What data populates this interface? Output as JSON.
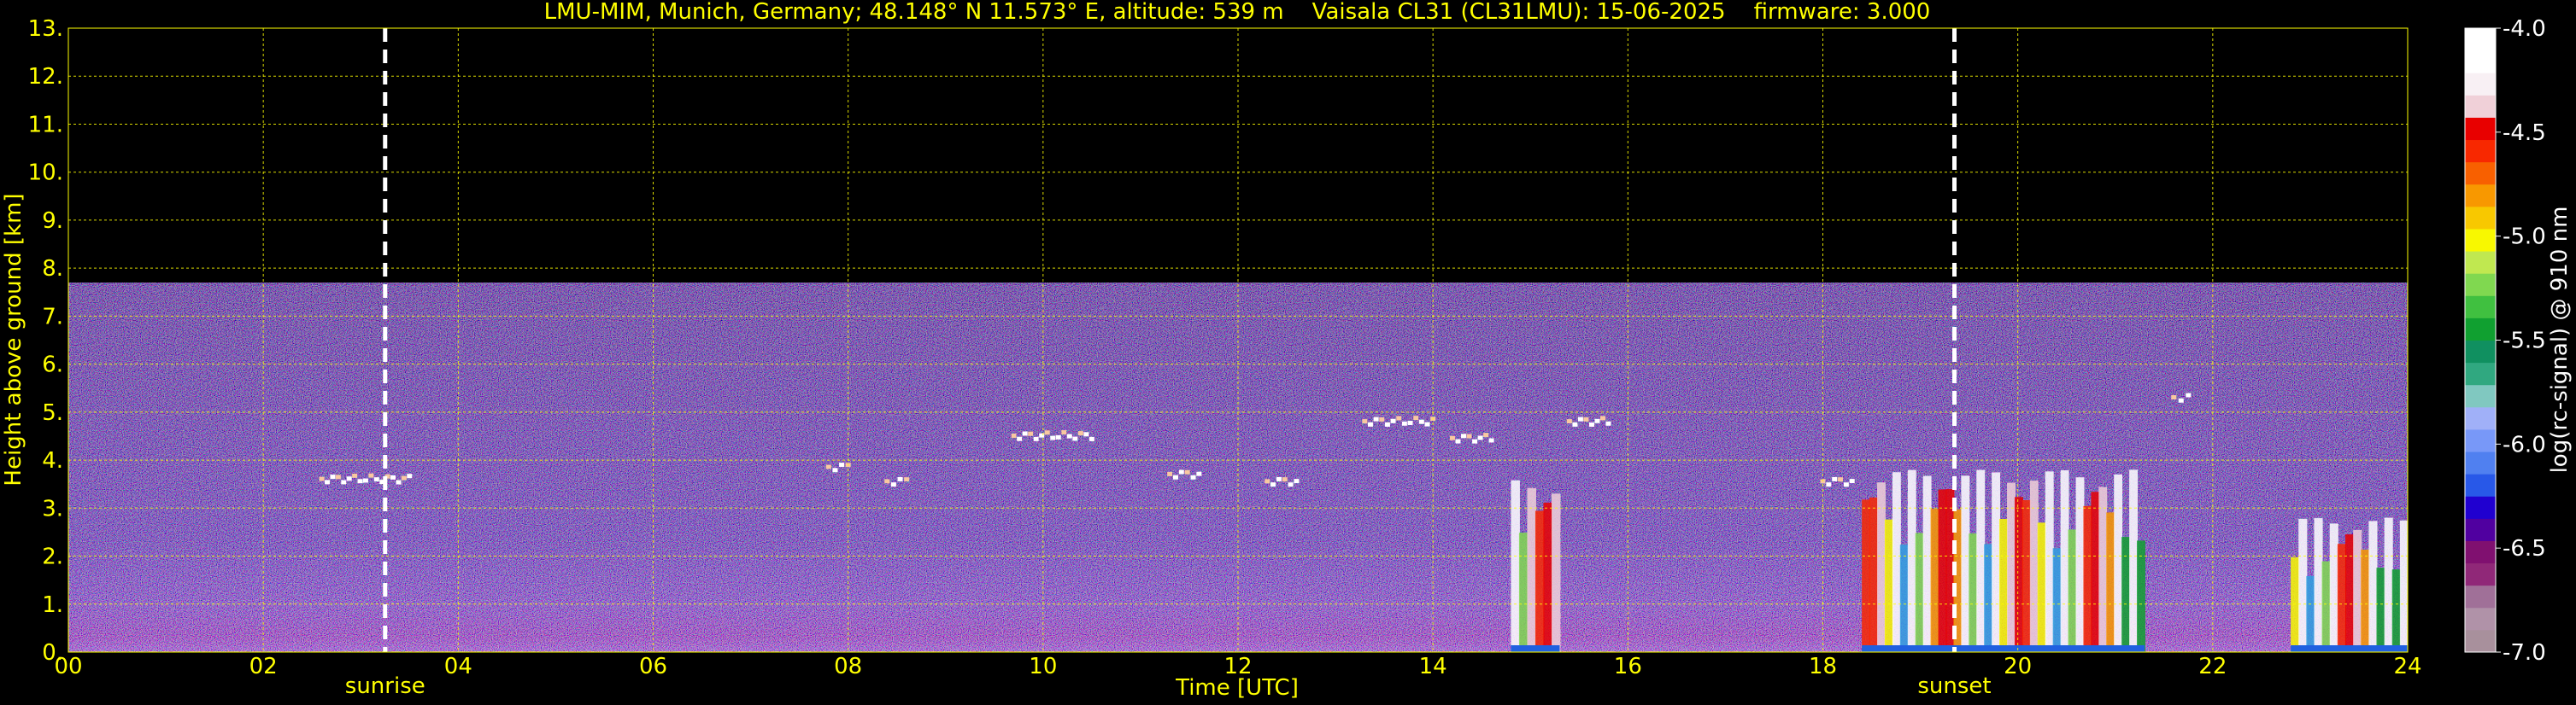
{
  "title": "LMU-MIM, Munich, Germany; 48.148° N 11.573° E, altitude: 539 m    Vaisala CL31 (CL31LMU): 15-06-2025    firmware: 3.000",
  "chart_data": {
    "type": "heatmap",
    "title": "LMU-MIM, Munich, Germany; 48.148° N 11.573° E, altitude: 539 m    Vaisala CL31 (CL31LMU): 15-06-2025    firmware: 3.000",
    "xlabel": "Time [UTC]",
    "ylabel": "Height above ground [km]",
    "xlim": [
      0,
      24
    ],
    "ylim": [
      0,
      13
    ],
    "x_ticks": [
      "00",
      "02",
      "04",
      "06",
      "08",
      "10",
      "12",
      "14",
      "16",
      "18",
      "20",
      "22",
      "24"
    ],
    "y_ticks": [
      "0.",
      "1.",
      "2.",
      "3.",
      "4.",
      "5.",
      "6.",
      "7.",
      "8.",
      "9.",
      "10.",
      "11.",
      "12.",
      "13."
    ],
    "grid": true,
    "grid_color": "#ffff00",
    "annotations": [
      {
        "label": "sunrise",
        "x": 3.25
      },
      {
        "label": "sunset",
        "x": 19.35
      }
    ],
    "colorbar": {
      "label": "log(rc-signal) @ 910 nm",
      "range": [
        -7.0,
        -4.0
      ],
      "ticks": [
        "-4.0",
        "-4.5",
        "-5.0",
        "-5.5",
        "-6.0",
        "-6.5",
        "-7.0"
      ],
      "colors": [
        "#a8909c",
        "#b092a8",
        "#a07098",
        "#902878",
        "#801070",
        "#5000a0",
        "#2000d0",
        "#2858e8",
        "#5080f0",
        "#7898f8",
        "#a0b0f8",
        "#80c8c0",
        "#30a880",
        "#109060",
        "#10a030",
        "#40c040",
        "#80d850",
        "#c0e850",
        "#f8f800",
        "#f8c800",
        "#f89800",
        "#f86000",
        "#f82800",
        "#e80000",
        "#f0d0d8",
        "#f8f0f4",
        "#ffffff",
        "#ffffff"
      ]
    },
    "data_top_km": 7.7,
    "cloud_layers": [
      {
        "t": [
          2.6,
          3.5
        ],
        "h": 3.6
      },
      {
        "t": [
          7.8,
          8.0
        ],
        "h": 3.85
      },
      {
        "t": [
          8.4,
          8.6
        ],
        "h": 3.55
      },
      {
        "t": [
          9.7,
          10.5
        ],
        "h": 4.5
      },
      {
        "t": [
          11.3,
          11.6
        ],
        "h": 3.7
      },
      {
        "t": [
          12.3,
          12.6
        ],
        "h": 3.55
      },
      {
        "t": [
          13.3,
          14.0
        ],
        "h": 4.8
      },
      {
        "t": [
          14.2,
          14.6
        ],
        "h": 4.45
      },
      {
        "t": [
          15.4,
          15.8
        ],
        "h": 4.8
      },
      {
        "t": [
          18.0,
          18.3
        ],
        "h": 3.55
      },
      {
        "t": [
          21.6,
          21.75
        ],
        "h": 5.3
      }
    ],
    "strong_signal_regions": [
      {
        "t": [
          14.8,
          15.3
        ],
        "h": [
          0,
          3.6
        ]
      },
      {
        "t": [
          18.4,
          21.3
        ],
        "h": [
          0,
          3.8
        ]
      },
      {
        "t": [
          22.8,
          24.0
        ],
        "h": [
          0,
          2.8
        ]
      }
    ]
  }
}
